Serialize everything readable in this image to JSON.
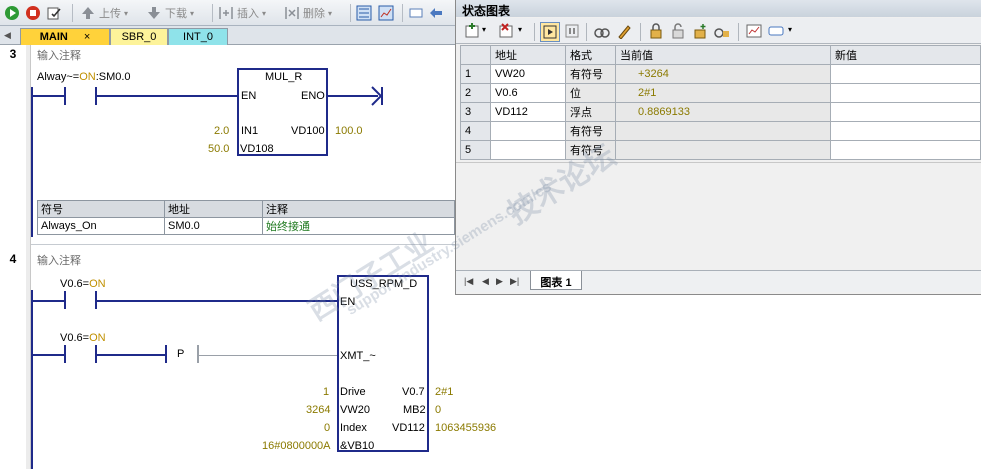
{
  "toolbar": {
    "upload_label": "上传",
    "download_label": "下载",
    "insert_label": "插入",
    "delete_label": "删除"
  },
  "tabs": [
    {
      "label": "MAIN",
      "close": "×"
    },
    {
      "label": "SBR_0"
    },
    {
      "label": "INT_0"
    }
  ],
  "network3": {
    "number": "3",
    "comment": "输入注释",
    "contact_label_prefix": "Alway~=",
    "contact_state": "ON",
    "contact_label_suffix": ":SM0.0",
    "box_title": "MUL_R",
    "en": "EN",
    "eno": "ENO",
    "in1_pin": "IN1",
    "in1_value": "2.0",
    "in2_pin": "VD108",
    "in2_value": "50.0",
    "out_pin": "VD100",
    "out_value": "100.0",
    "symbols": {
      "headers": [
        "符号",
        "地址",
        "注释"
      ],
      "rows": [
        [
          "Always_On",
          "SM0.0",
          "始终接通"
        ]
      ]
    }
  },
  "network4": {
    "number": "4",
    "comment": "输入注释",
    "contact1_prefix": "V0.6=",
    "contact1_state": "ON",
    "contact2_prefix": "V0.6=",
    "contact2_state": "ON",
    "p_label": "P",
    "box_title": "USS_RPM_D",
    "en": "EN",
    "xmt": "XMT_~",
    "drive_pin": "Drive",
    "drive_value": "1",
    "vw_pin": "VW20",
    "vw_value": "3264",
    "index_pin": "Index",
    "index_value": "0",
    "vb_pin": "&VB10",
    "vb_value": "16#0800000A",
    "out1_pin": "V0.7",
    "out1_value": "2#1",
    "out2_pin": "MB2",
    "out2_value": "0",
    "out3_pin": "VD112",
    "out3_value": "1063455936"
  },
  "status_chart": {
    "title": "状态图表",
    "headers": [
      "",
      "地址",
      "格式",
      "当前值",
      "新值"
    ],
    "rows": [
      {
        "n": "1",
        "addr": "VW20",
        "fmt": "有符号",
        "cur": "+3264",
        "new": ""
      },
      {
        "n": "2",
        "addr": "V0.6",
        "fmt": "位",
        "cur": "2#1",
        "new": ""
      },
      {
        "n": "3",
        "addr": "VD112",
        "fmt": "浮点",
        "cur": "0.8869133",
        "new": ""
      },
      {
        "n": "4",
        "addr": "",
        "fmt": "有符号",
        "cur": "",
        "new": ""
      },
      {
        "n": "5",
        "addr": "",
        "fmt": "有符号",
        "cur": "",
        "new": ""
      }
    ],
    "sheet_tab": "图表 1"
  },
  "watermark": {
    "line1": "西门子工业",
    "line2": "support.industry.siemens.com/cs",
    "line3": "技术论坛"
  },
  "colors": {
    "wire": "#1f2a8a",
    "value": "#8b7a00",
    "on_state": "#c09000"
  }
}
